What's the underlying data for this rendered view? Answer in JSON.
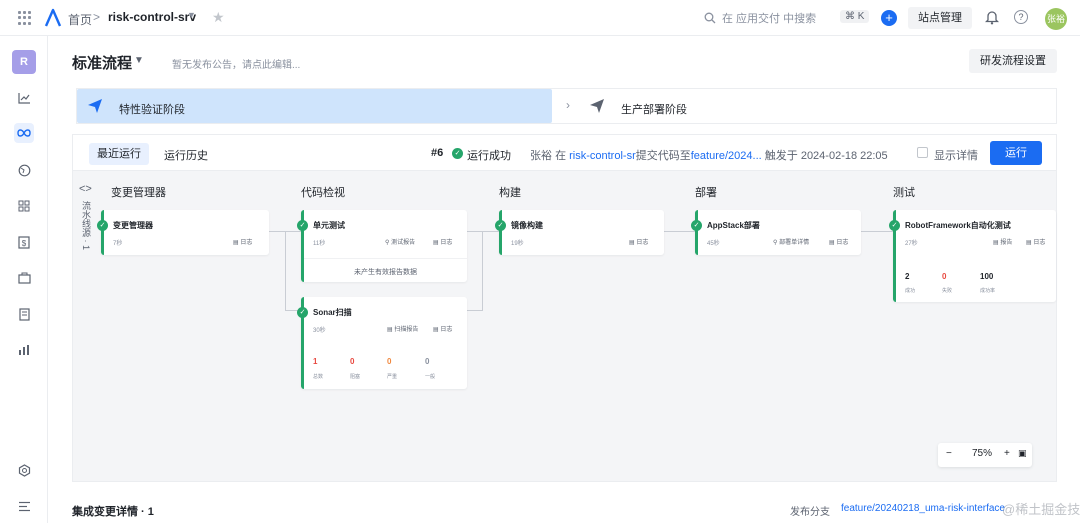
{
  "topbar": {
    "home": "首页",
    "separator": ">",
    "project": "risk-control-srv",
    "search_placeholder": "在 应用交付 中搜索",
    "shortcut": "⌘ K",
    "site_manage": "站点管理",
    "avatar_text": "张裕"
  },
  "sidebar": {
    "badge": "R"
  },
  "header": {
    "title": "标准流程",
    "notice": "暂无发布公告，请点此编辑...",
    "settings_button": "研发流程设置"
  },
  "stages": [
    {
      "label": "特性验证阶段",
      "active": true
    },
    {
      "label": "生产部署阶段",
      "active": false
    }
  ],
  "runbar": {
    "tab_recent": "最近运行",
    "tab_history": "运行历史",
    "run_number": "#6",
    "status": "运行成功",
    "user": "张裕",
    "in_text": "在",
    "repo": "risk-control-sr",
    "commit_text": "提交代码至",
    "branch": "feature/2024...",
    "trigger_text": "触发于 2024-02-18 22:05",
    "show_details": "显示详情",
    "run_button": "运行"
  },
  "pipeline": {
    "line_label": "流水线源 · 1",
    "columns": [
      {
        "title": "变更管理器"
      },
      {
        "title": "代码检视"
      },
      {
        "title": "构建"
      },
      {
        "title": "部署"
      },
      {
        "title": "测试"
      }
    ],
    "jobs": {
      "change_manager": {
        "name": "变更管理器",
        "time": "7秒",
        "log": "日志"
      },
      "unit_test": {
        "name": "单元测试",
        "time": "11秒",
        "report": "测试报告",
        "log": "日志",
        "empty": "未产生有效报告数据"
      },
      "sonar": {
        "name": "Sonar扫描",
        "time": "30秒",
        "report": "扫描报告",
        "log": "日志",
        "stats": [
          {
            "value": "1",
            "label": "总数",
            "color": "#e8483f"
          },
          {
            "value": "0",
            "label": "阻塞",
            "color": "#e8483f"
          },
          {
            "value": "0",
            "label": "严重",
            "color": "#f0883e"
          },
          {
            "value": "0",
            "label": "一般",
            "color": "#8a919f"
          }
        ]
      },
      "image_build": {
        "name": "镜像构建",
        "time": "19秒",
        "log": "日志"
      },
      "appstack": {
        "name": "AppStack部署",
        "time": "45秒",
        "report": "部署单详情",
        "log": "日志"
      },
      "robot": {
        "name": "RobotFramework自动化测试",
        "time": "27秒",
        "report": "报告",
        "log": "日志",
        "stats": [
          {
            "value": "2",
            "label": "成功",
            "color": "#1f2329"
          },
          {
            "value": "0",
            "label": "失败",
            "color": "#e8483f"
          },
          {
            "value": "100",
            "label": "成功率",
            "color": "#1f2329"
          }
        ]
      }
    },
    "zoom": {
      "minus": "−",
      "level": "75%",
      "plus": "+"
    }
  },
  "footer": {
    "title": "集成变更详情 · 1",
    "branch_label": "发布分支",
    "branch_value": "feature/20240218_uma-risk-interface"
  },
  "watermark": "@稀土掘金技术社区"
}
